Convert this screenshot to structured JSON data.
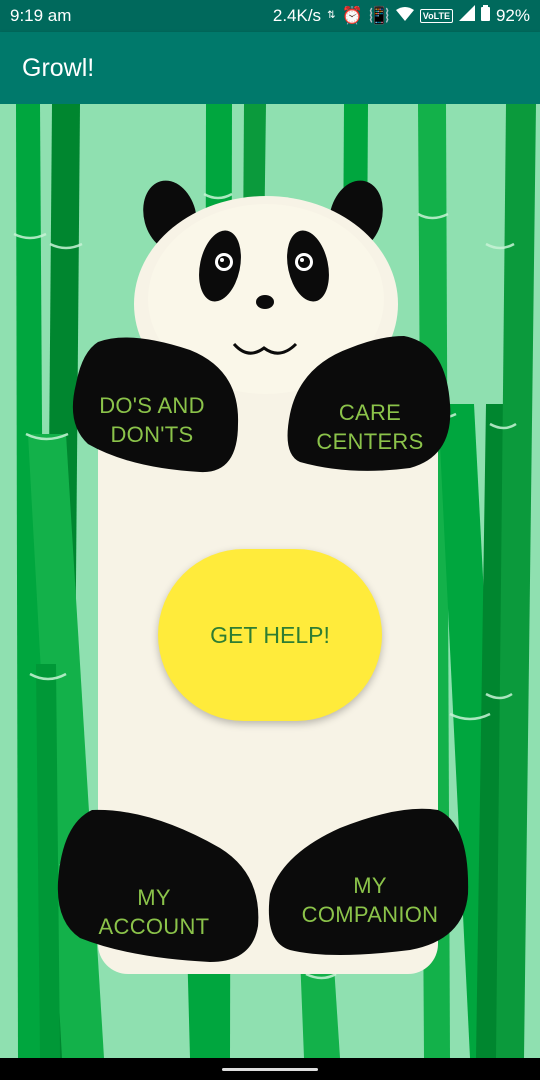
{
  "status": {
    "time": "9:19 am",
    "speed": "2.4K/s",
    "network_badge": "VoLTE",
    "battery": "92%"
  },
  "app": {
    "title": "Growl!"
  },
  "buttons": {
    "dos_donts": [
      "DO'S AND",
      "DON'TS"
    ],
    "care_centers": [
      "CARE",
      "CENTERS"
    ],
    "get_help": "GET HELP!",
    "my_account": [
      "MY",
      "ACCOUNT"
    ],
    "my_companion": [
      "MY",
      "COMPANION"
    ]
  },
  "colors": {
    "status_bar": "#00695c",
    "app_bar": "#00796b",
    "background": "#8fe0b0",
    "panda_body": "#f7f3e6",
    "panda_black": "#0b0b0b",
    "button_text": "#8bc34a",
    "help_button": "#ffeb3b",
    "help_text": "#2e7d32"
  }
}
